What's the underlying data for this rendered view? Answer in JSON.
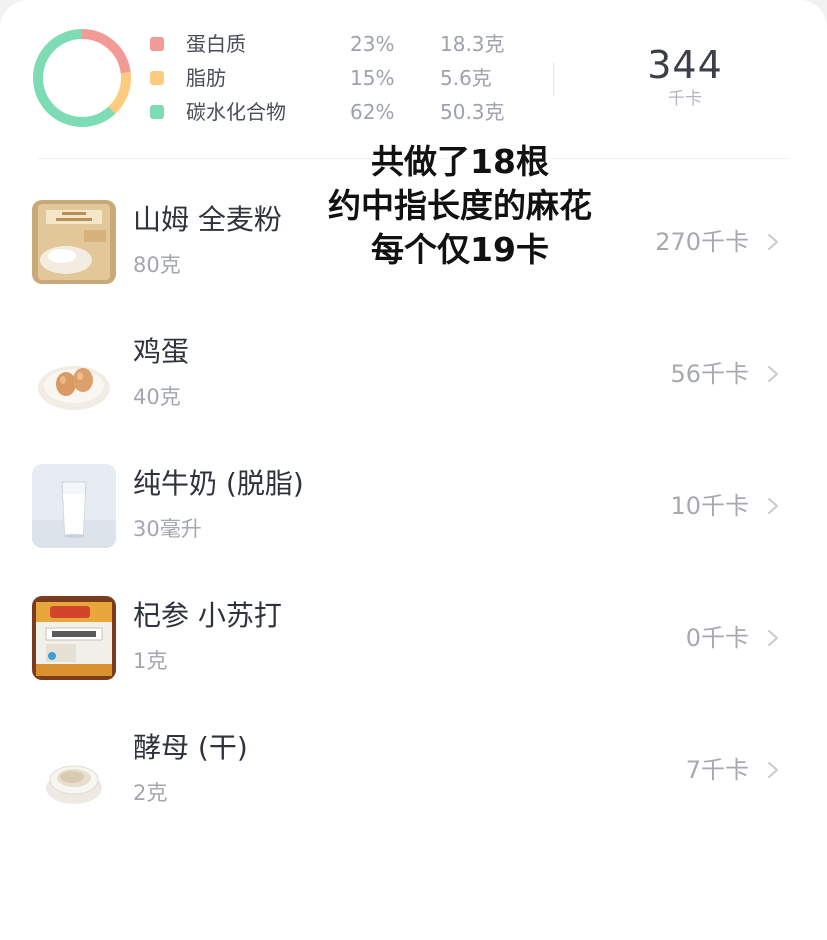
{
  "summary": {
    "macros": [
      {
        "name": "蛋白质",
        "pct": "23%",
        "amount": "18.3克",
        "color": "#f29a96"
      },
      {
        "name": "脂肪",
        "pct": "15%",
        "amount": "5.6克",
        "color": "#fccb7e"
      },
      {
        "name": "碳水化合物",
        "pct": "62%",
        "amount": "50.3克",
        "color": "#7edcb5"
      }
    ],
    "total_kcal": "344",
    "total_unit": "千卡"
  },
  "foods": [
    {
      "name": "山姆 全麦粉",
      "amount": "80克",
      "kcal": "270千卡",
      "icon": "flour-bag-thumbnail"
    },
    {
      "name": "鸡蛋",
      "amount": "40克",
      "kcal": "56千卡",
      "icon": "eggs-plate-thumbnail"
    },
    {
      "name": "纯牛奶 (脱脂)",
      "amount": "30毫升",
      "kcal": "10千卡",
      "icon": "milk-glass-thumbnail"
    },
    {
      "name": "杞参 小苏打",
      "amount": "1克",
      "kcal": "0千卡",
      "icon": "baking-soda-thumbnail"
    },
    {
      "name": "酵母 (干)",
      "amount": "2克",
      "kcal": "7千卡",
      "icon": "yeast-bowl-thumbnail"
    }
  ],
  "caption": {
    "line1": "共做了18根",
    "line2": "约中指长度的麻花",
    "line3": "每个仅19卡"
  }
}
